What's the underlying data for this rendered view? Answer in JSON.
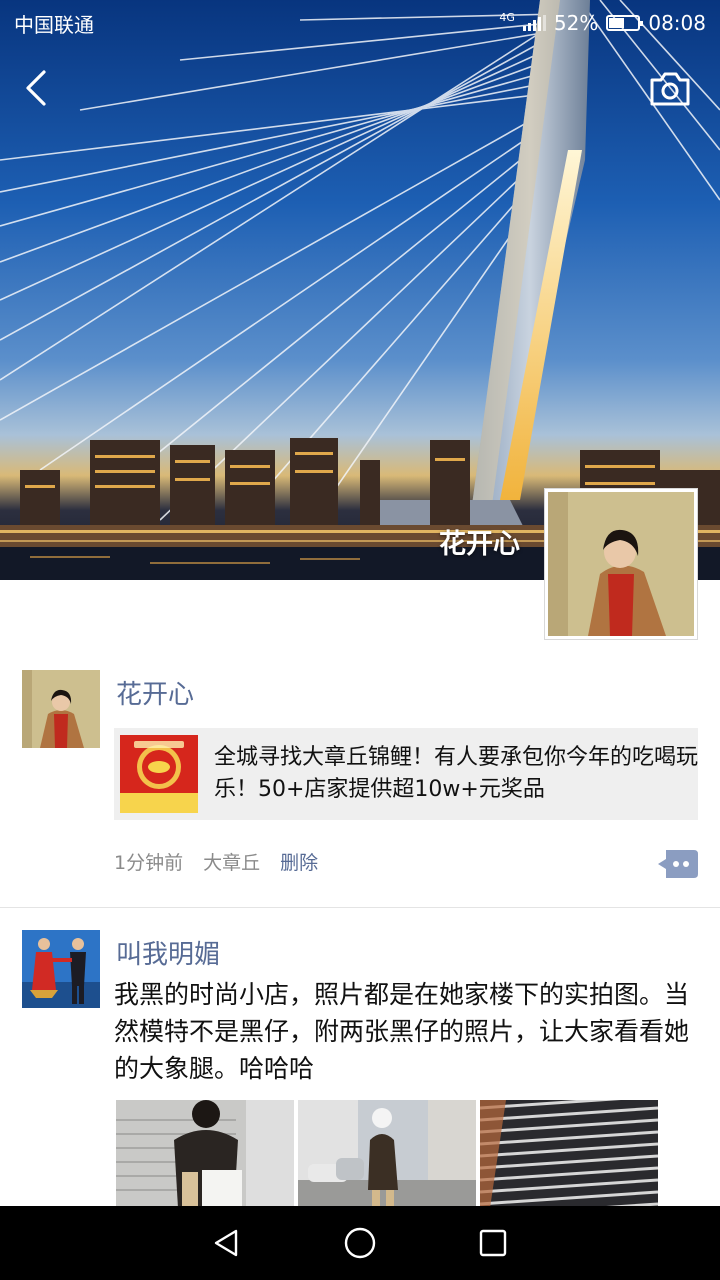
{
  "status_bar": {
    "carrier": "中国联通",
    "network": "4G",
    "battery": "52%",
    "battery_level": 0.52,
    "time": "08:08"
  },
  "nav": {
    "back_icon": "chevron-left-icon",
    "camera_icon": "camera-icon"
  },
  "profile": {
    "name": "花开心"
  },
  "posts": [
    {
      "author": "花开心",
      "link": {
        "text": "全城寻找大章丘锦鲤！有人要承包你今年的吃喝玩乐！50+店家提供超10w+元奖品",
        "thumb_icon": "koi-promo-thumbnail"
      },
      "time": "1分钟前",
      "location": "大章丘",
      "delete_label": "删除",
      "comment_icon": "comment-dots-icon"
    },
    {
      "author": "叫我明媚",
      "text": "我黑的时尚小店，照片都是在她家楼下的实拍图。当然模特不是黑仔，附两张黑仔的照片，让大家看看她的大象腿。哈哈哈",
      "photos": [
        "photo-1",
        "photo-2",
        "photo-3"
      ]
    }
  ],
  "navbar": {
    "back_icon": "triangle-back-icon",
    "home_icon": "circle-home-icon",
    "recents_icon": "square-recents-icon"
  }
}
